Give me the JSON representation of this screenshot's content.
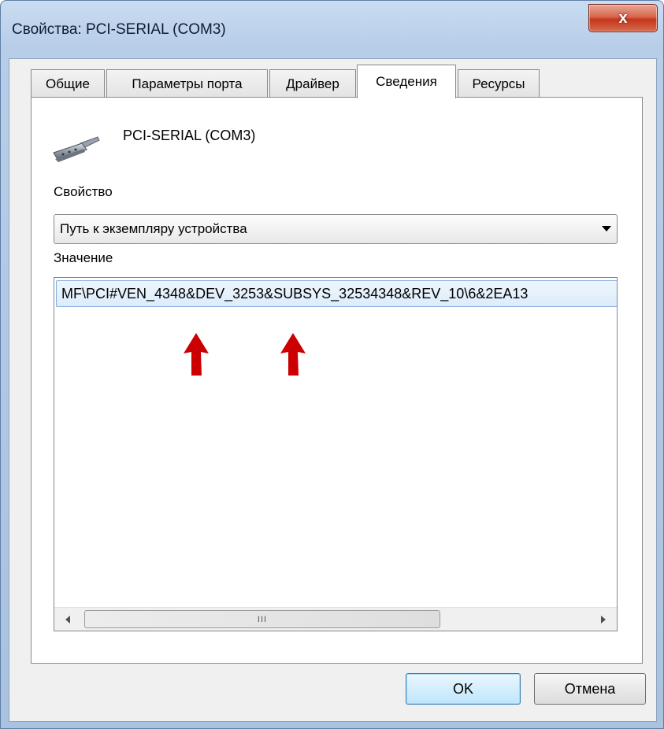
{
  "window": {
    "title": "Свойства: PCI-SERIAL (COM3)",
    "close_glyph": "x"
  },
  "tabs": [
    {
      "label": "Общие",
      "active": false
    },
    {
      "label": "Параметры порта",
      "active": false
    },
    {
      "label": "Драйвер",
      "active": false
    },
    {
      "label": "Сведения",
      "active": true
    },
    {
      "label": "Ресурсы",
      "active": false
    }
  ],
  "details": {
    "device_icon": "serial-port-connector-icon",
    "device_name": "PCI-SERIAL (COM3)",
    "property_label": "Свойство",
    "property_selected": "Путь к экземпляру устройства",
    "value_label": "Значение",
    "value_items": [
      "MF\\PCI#VEN_4348&DEV_3253&SUBSYS_32534348&REV_10\\6&2EA13"
    ],
    "scroll_thumb_grip": "III"
  },
  "buttons": {
    "ok": "OK",
    "cancel": "Отмена"
  },
  "colors": {
    "annotation_arrow": "#cc0000",
    "selection_border": "#84acdd",
    "default_button_border": "#3c7fb1"
  }
}
